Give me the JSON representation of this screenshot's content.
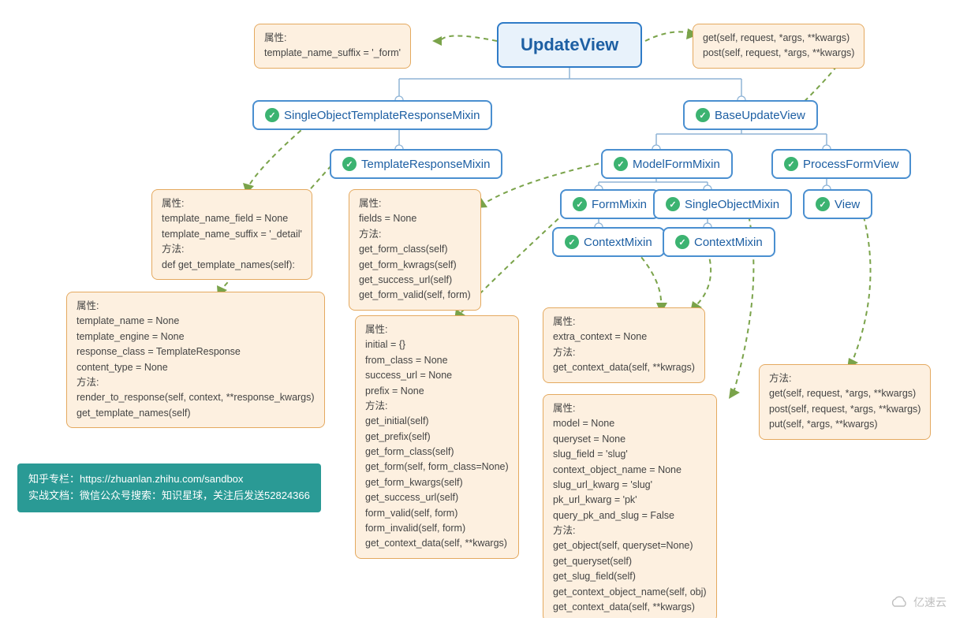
{
  "title": "UpdateView",
  "classes": {
    "sotrm": "SingleObjectTemplateResponseMixin",
    "buv": "BaseUpdateView",
    "trm": "TemplateResponseMixin",
    "mfm": "ModelFormMixin",
    "pfv": "ProcessFormView",
    "fm": "FormMixin",
    "som": "SingleObjectMixin",
    "view": "View",
    "cm1": "ContextMixin",
    "cm2": "ContextMixin"
  },
  "boxes": {
    "b0": "属性:\ntemplate_name_suffix = '_form'",
    "b1": "get(self, request, *args, **kwargs)\npost(self, request, *args, **kwargs)",
    "b2": "属性:\ntemplate_name_field = None\ntemplate_name_suffix = '_detail'\n方法:\ndef get_template_names(self):",
    "b3": "属性:\nfields = None\n方法:\nget_form_class(self)\nget_form_kwrags(self)\nget_success_url(self)\nget_form_valid(self, form)",
    "b4": "属性:\ntemplate_name = None\ntemplate_engine = None\nresponse_class = TemplateResponse\ncontent_type = None\n方法:\nrender_to_response(self, context, **response_kwargs)\nget_template_names(self)",
    "b5": "属性:\ninitial = {}\nfrom_class = None\nsuccess_url = None\nprefix = None\n方法:\nget_initial(self)\nget_prefix(self)\nget_form_class(self)\nget_form(self, form_class=None)\nget_form_kwargs(self)\nget_success_url(self)\nform_valid(self, form)\nform_invalid(self, form)\nget_context_data(self, **kwargs)",
    "b6": "属性:\nextra_context = None\n方法:\nget_context_data(self, **kwrags)",
    "b7": "属性:\nmodel = None\nqueryset = None\nslug_field = 'slug'\ncontext_object_name = None\nslug_url_kwarg = 'slug'\npk_url_kwarg = 'pk'\nquery_pk_and_slug = False\n方法:\nget_object(self, queryset=None)\nget_queryset(self)\nget_slug_field(self)\nget_context_object_name(self, obj)\nget_context_data(self, **kwargs)",
    "b8": "方法:\nget(self, request, *args, **kwargs)\npost(self, request, *args, **kwargs)\nput(self, *args, **kwargs)"
  },
  "footer": {
    "l1": "知乎专栏：https://zhuanlan.zhihu.com/sandbox",
    "l2": "实战文档：微信公众号搜索：知识星球，关注后发送52824366"
  },
  "watermark": "亿速云"
}
